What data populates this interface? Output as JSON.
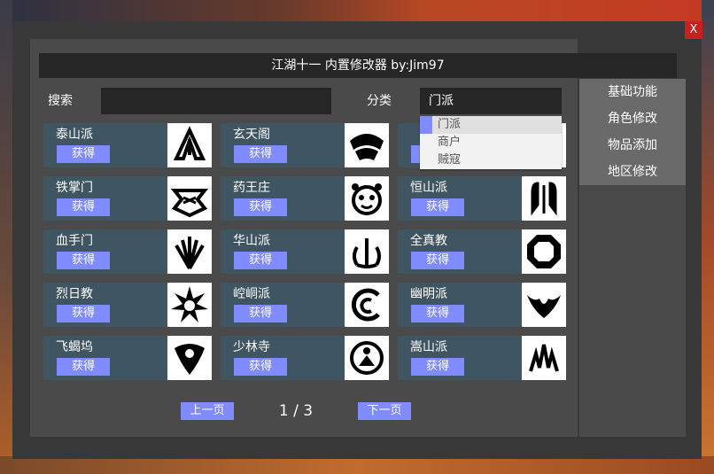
{
  "window": {
    "title": "江湖十一 内置修改器 by:Jim97",
    "close_label": "X"
  },
  "search": {
    "label": "搜索",
    "value": ""
  },
  "category": {
    "label": "分类",
    "selected": "门派",
    "options": [
      "门派",
      "商户",
      "贼寇"
    ]
  },
  "sidebar": {
    "items": [
      "基础功能",
      "角色修改",
      "物品添加",
      "地区修改"
    ]
  },
  "obtain_label": "获得",
  "cards": [
    {
      "name": "泰山派",
      "icon": "taishan-emblem-icon"
    },
    {
      "name": "玄天阁",
      "icon": "xuantian-emblem-icon"
    },
    {
      "name": "",
      "icon": "hidden-emblem-icon"
    },
    {
      "name": "铁掌门",
      "icon": "tiezhang-emblem-icon"
    },
    {
      "name": "药王庄",
      "icon": "yaowang-emblem-icon"
    },
    {
      "name": "恒山派",
      "icon": "hengshan-emblem-icon"
    },
    {
      "name": "血手门",
      "icon": "xueshou-emblem-icon"
    },
    {
      "name": "华山派",
      "icon": "huashan-emblem-icon"
    },
    {
      "name": "全真教",
      "icon": "quanzhen-emblem-icon"
    },
    {
      "name": "烈日教",
      "icon": "lieri-emblem-icon"
    },
    {
      "name": "崆峒派",
      "icon": "kongtong-emblem-icon"
    },
    {
      "name": "幽明派",
      "icon": "youming-emblem-icon"
    },
    {
      "name": "飞蝎坞",
      "icon": "feixie-emblem-icon"
    },
    {
      "name": "少林寺",
      "icon": "shaolin-emblem-icon"
    },
    {
      "name": "嵩山派",
      "icon": "songshan-emblem-icon"
    }
  ],
  "pagination": {
    "prev": "上一页",
    "next": "下一页",
    "indicator": "1 / 3"
  },
  "colors": {
    "accent": "#7f8bff",
    "card": "#3f5561",
    "close": "#c8201c"
  }
}
